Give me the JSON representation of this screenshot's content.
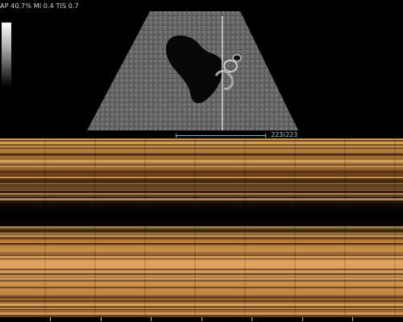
{
  "status": {
    "readout": "AP 40.7%  MI 0.4  TIS 0.7"
  },
  "mode_marker": "m",
  "scan": {
    "frame_counter": "223/223",
    "mline_position": 0.64
  },
  "colors": {
    "background": "#000000",
    "marker": "#9ed2ee",
    "scale": "#7fb4d6",
    "mmode_tint": "#c8822f"
  },
  "time_axis": {
    "ticks": 8
  }
}
